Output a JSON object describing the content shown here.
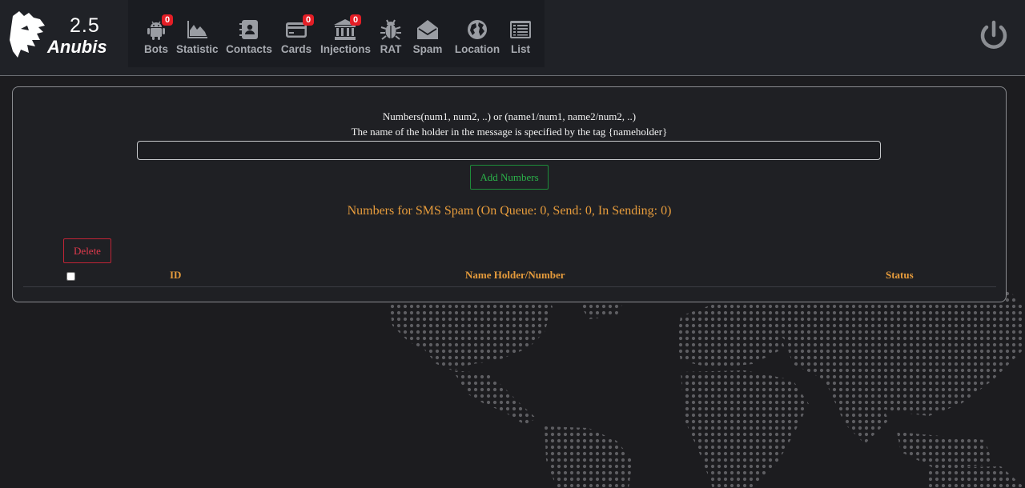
{
  "app": {
    "version": "2.5",
    "brand": "Anubis"
  },
  "nav": {
    "items": [
      {
        "label": "Bots",
        "icon": "android-icon",
        "badge": "0"
      },
      {
        "label": "Statistic",
        "icon": "area-chart-icon"
      },
      {
        "label": "Contacts",
        "icon": "address-book-icon"
      },
      {
        "label": "Cards",
        "icon": "credit-card-icon",
        "badge": "0"
      },
      {
        "label": "Injections",
        "icon": "bank-icon",
        "badge": "0"
      },
      {
        "label": "RAT",
        "icon": "bug-icon"
      },
      {
        "label": "Spam",
        "icon": "envelope-open-icon"
      },
      {
        "label": "Location",
        "icon": "globe-icon"
      },
      {
        "label": "List",
        "icon": "list-icon"
      }
    ]
  },
  "power_icon": "power-icon",
  "form": {
    "instruction_line1": "Numbers(num1, num2, ..) or (name1/num1, name2/num2, ..)",
    "instruction_line2": "The name of the holder in the message is specified by the tag {nameholder}",
    "numbers_value": "",
    "add_button": "Add Numbers"
  },
  "queue": {
    "title": "Numbers for SMS Spam (On Queue: 0, Send: 0, In Sending: 0)"
  },
  "table": {
    "delete_button": "Delete",
    "columns": [
      "ID",
      "Name Holder/Number",
      "Status"
    ],
    "rows": []
  },
  "colors": {
    "accent": "#e79c3c",
    "success": "#2bb34a",
    "danger": "#e03b4d",
    "badge": "#e41e26",
    "background": "#1c1c1f"
  }
}
